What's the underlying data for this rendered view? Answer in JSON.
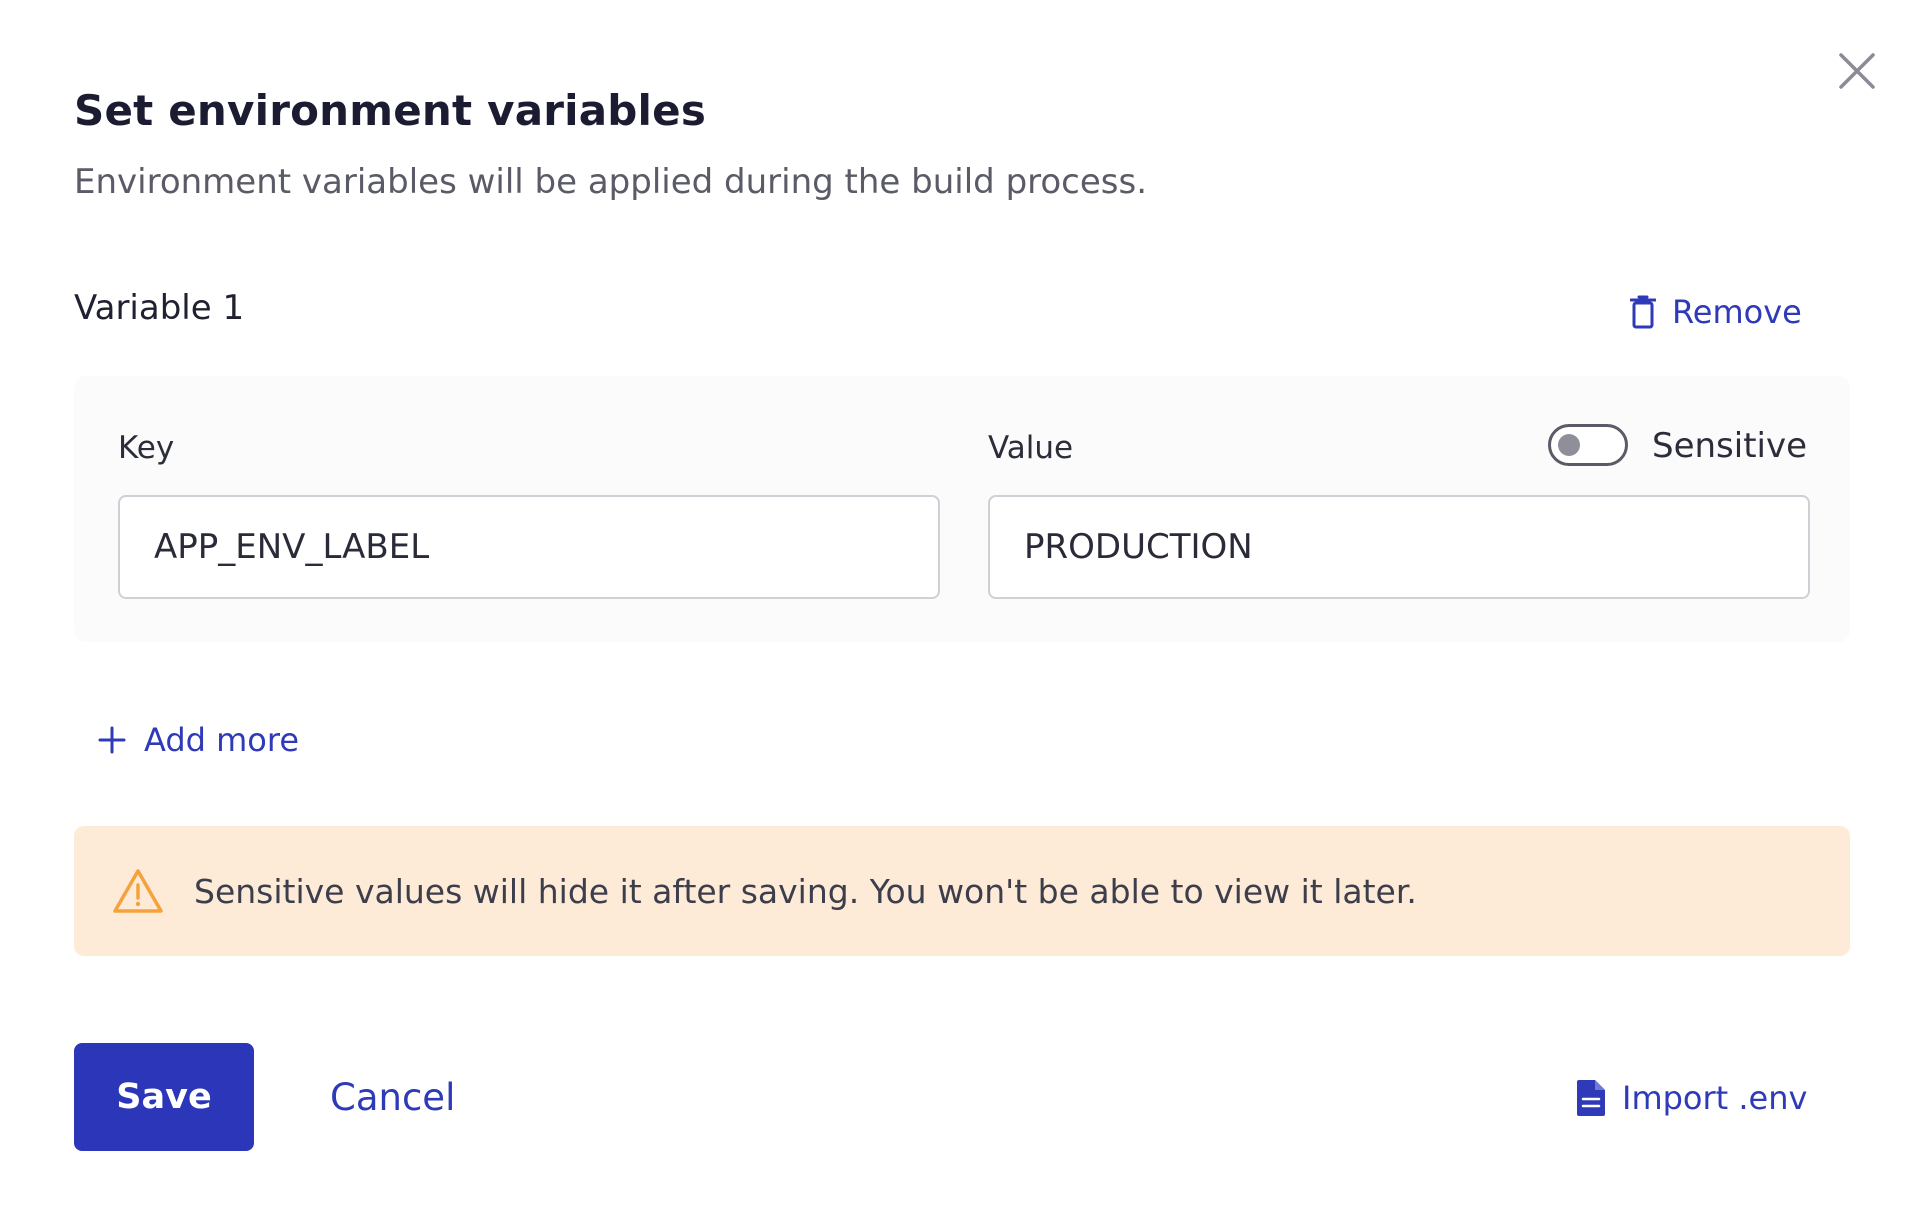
{
  "dialog": {
    "title": "Set environment variables",
    "subtitle": "Environment variables will be applied during the build process."
  },
  "variable": {
    "title": "Variable 1",
    "remove_label": "Remove",
    "key_label": "Key",
    "key_value": "APP_ENV_LABEL",
    "value_label": "Value",
    "value_value": "PRODUCTION",
    "sensitive_label": "Sensitive",
    "sensitive_on": false
  },
  "add_more_label": "Add more",
  "warning": {
    "text": "Sensitive values will hide it after saving. You won't be able to view it later."
  },
  "footer": {
    "save_label": "Save",
    "cancel_label": "Cancel",
    "import_label": "Import .env"
  },
  "colors": {
    "accent": "#2f3ab8",
    "primary_button": "#2b36b8",
    "warning_bg": "#fdebd8",
    "warning_icon": "#f5a13c"
  },
  "icons": {
    "close": "close-icon",
    "remove": "trash-icon",
    "add": "plus-icon",
    "warning": "warning-triangle-icon",
    "import": "file-icon"
  }
}
